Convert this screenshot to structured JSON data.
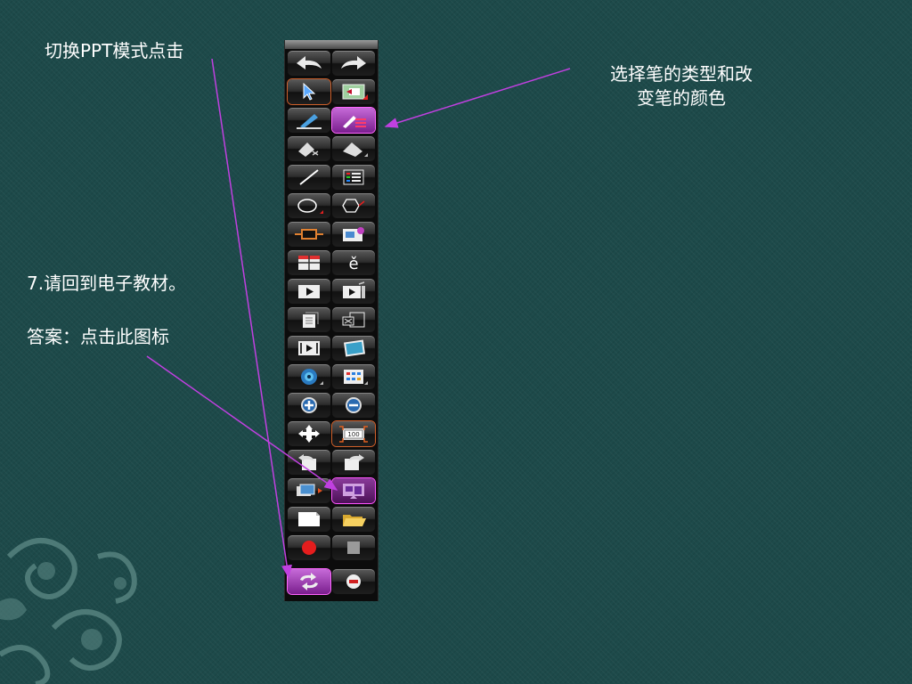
{
  "annotations": {
    "switch_ppt": "切换PPT模式点击",
    "pen_select_line1": "选择笔的类型和改",
    "pen_select_line2": "变笔的颜色",
    "question": "7.请回到电子教材。",
    "answer": "答案：点击此图标"
  },
  "colors": {
    "background": "#1d4a4a",
    "callout_line": "#c040e0",
    "highlight": "#c66ad8"
  },
  "toolbar": {
    "rows": [
      [
        "undo-icon",
        "redo-icon"
      ],
      [
        "select-arrow-icon",
        "page-switch-icon"
      ],
      [
        "pen-icon",
        "pen-type-color-icon"
      ],
      [
        "eraser-icon",
        "eraser-area-icon"
      ],
      [
        "line-icon",
        "text-lines-icon"
      ],
      [
        "ellipse-icon",
        "polygon-icon"
      ],
      [
        "rectangle-icon",
        "insert-image-icon"
      ],
      [
        "table-icon",
        "pinyin-icon"
      ],
      [
        "play-icon",
        "play-media-icon"
      ],
      [
        "document-icon",
        "close-doc-icon"
      ],
      [
        "video-icon",
        "picture-icon"
      ],
      [
        "camera-icon",
        "grid-icon"
      ],
      [
        "zoom-in-icon",
        "zoom-out-icon"
      ],
      [
        "move-icon",
        "zoom-100-icon"
      ],
      [
        "undo-page-icon",
        "redo-page-icon"
      ],
      [
        "screen-capture-icon",
        "e-textbook-icon"
      ],
      [
        "new-page-icon",
        "open-folder-icon"
      ],
      [
        "record-icon",
        "stop-icon"
      ],
      [
        "ppt-mode-switch-icon",
        "exit-icon"
      ]
    ],
    "zoom_label": "100"
  }
}
